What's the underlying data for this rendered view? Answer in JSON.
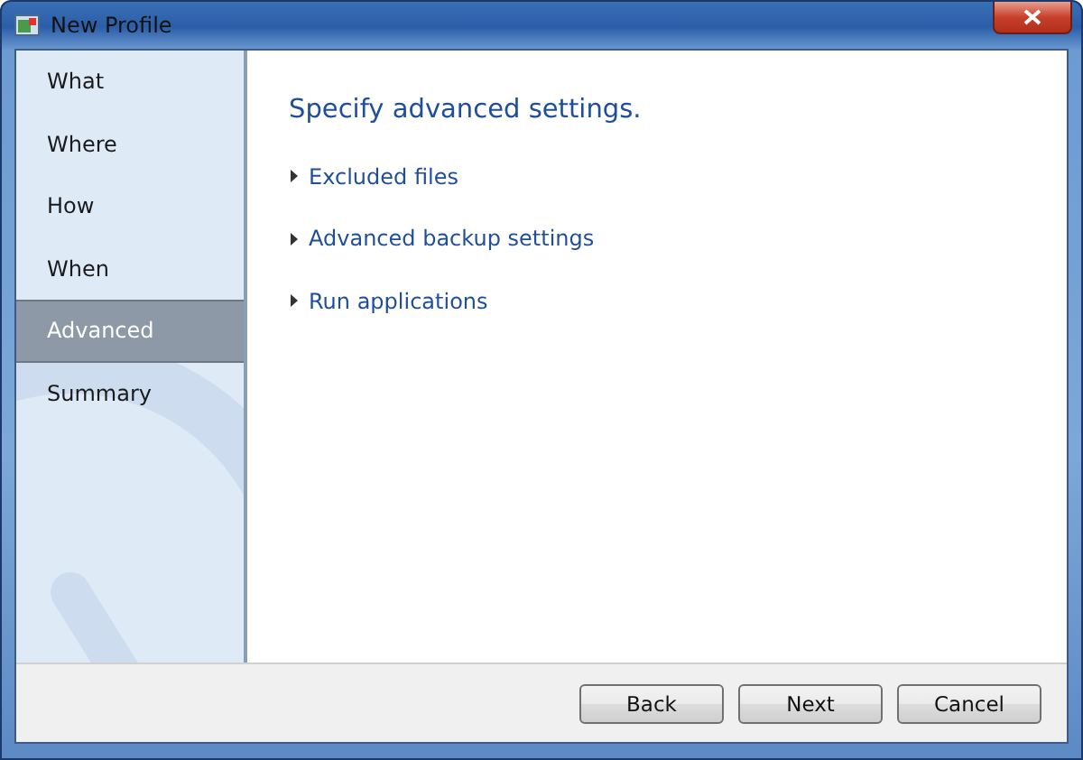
{
  "window": {
    "title": "New Profile"
  },
  "sidebar": {
    "items": [
      {
        "label": "What",
        "selected": false
      },
      {
        "label": "Where",
        "selected": false
      },
      {
        "label": "How",
        "selected": false
      },
      {
        "label": "When",
        "selected": false
      },
      {
        "label": "Advanced",
        "selected": true
      },
      {
        "label": "Summary",
        "selected": false
      }
    ]
  },
  "content": {
    "heading": "Specify advanced settings.",
    "sections": [
      {
        "label": "Excluded files",
        "expanded": false
      },
      {
        "label": "Advanced backup settings",
        "expanded": false
      },
      {
        "label": "Run applications",
        "expanded": false
      }
    ]
  },
  "buttons": [
    "Back",
    "Next",
    "Cancel"
  ]
}
